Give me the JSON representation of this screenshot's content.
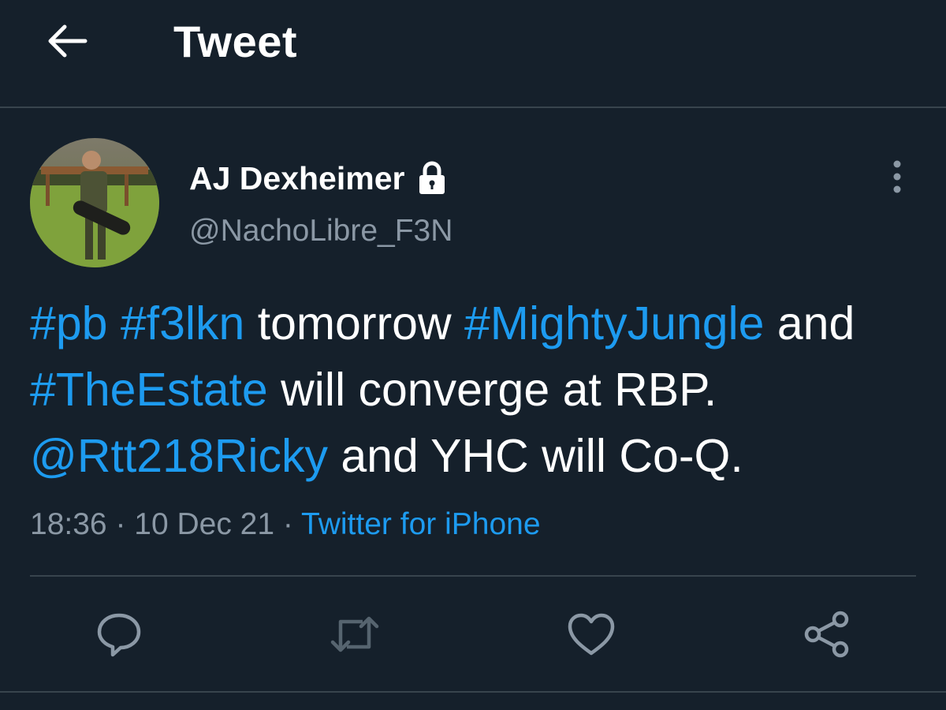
{
  "header": {
    "title": "Tweet",
    "back_icon": "arrow-left-icon"
  },
  "author": {
    "name": "AJ Dexheimer",
    "handle": "@NachoLibre_F3N",
    "protected_icon": "lock-icon",
    "avatar_icon": "avatar-photo"
  },
  "tweet": {
    "segments": [
      {
        "text": "#pb",
        "link": true
      },
      {
        "text": " ",
        "link": false
      },
      {
        "text": "#f3lkn",
        "link": true
      },
      {
        "text": " tomorrow ",
        "link": false
      },
      {
        "text": "#MightyJungle",
        "link": true
      },
      {
        "text": " and ",
        "link": false
      },
      {
        "text": "#TheEstate",
        "link": true
      },
      {
        "text": " will converge at RBP. ",
        "link": false
      },
      {
        "text": "@Rtt218Ricky",
        "link": true
      },
      {
        "text": " and YHC will Co-Q.",
        "link": false
      }
    ],
    "time": "18:36",
    "date": "10 Dec 21",
    "separator": "·",
    "source": "Twitter for iPhone"
  },
  "actions": [
    {
      "name": "reply",
      "icon": "reply-icon"
    },
    {
      "name": "retweet",
      "icon": "retweet-icon"
    },
    {
      "name": "like",
      "icon": "heart-icon"
    },
    {
      "name": "share",
      "icon": "share-icon"
    }
  ],
  "colors": {
    "background": "#15202b",
    "accent": "#1d9bf0",
    "secondary_text": "#8b98a5",
    "divider": "#38444d",
    "icon": "#8b98a5"
  }
}
